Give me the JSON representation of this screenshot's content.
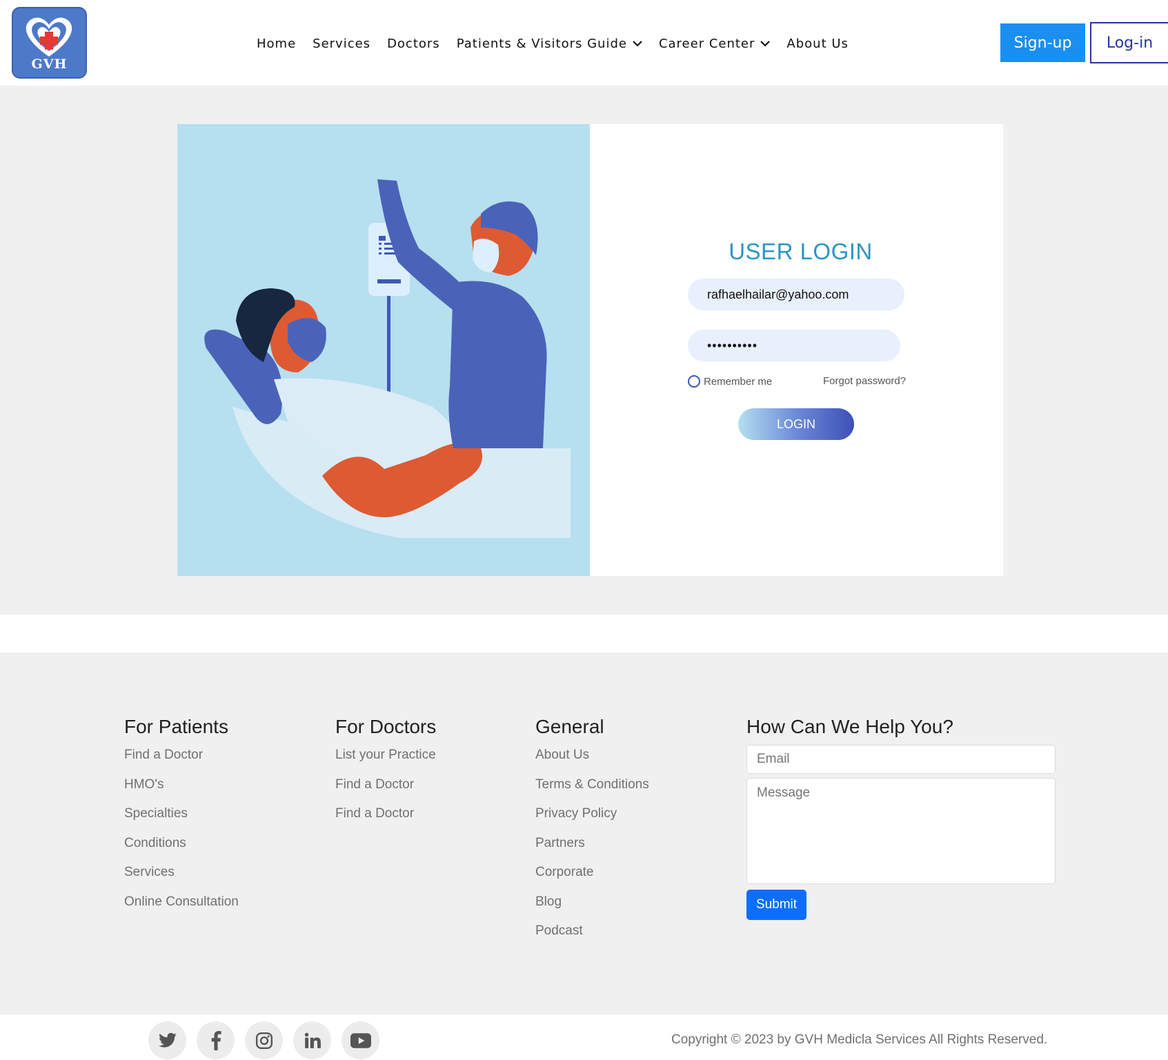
{
  "brand": {
    "logo_text": "GVH"
  },
  "nav": {
    "items": [
      {
        "label": "Home",
        "dropdown": false
      },
      {
        "label": "Services",
        "dropdown": false
      },
      {
        "label": "Doctors",
        "dropdown": false
      },
      {
        "label": "Patients & Visitors Guide",
        "dropdown": true
      },
      {
        "label": "Career Center",
        "dropdown": true
      },
      {
        "label": "About Us",
        "dropdown": false
      }
    ],
    "signup_label": "Sign-up",
    "login_label": "Log-in"
  },
  "login": {
    "title": "USER LOGIN",
    "email_value": "rafhaelhailar@yahoo.com",
    "password_value": "••••••••••",
    "remember_label": "Remember me",
    "forgot_label": "Forgot password?",
    "button_label": "LOGIN"
  },
  "footer": {
    "for_patients": {
      "title": "For Patients",
      "links": [
        "Find a Doctor",
        "HMO's",
        "Specialties",
        "Conditions",
        "Services",
        "Online Consultation"
      ]
    },
    "for_doctors": {
      "title": "For Doctors",
      "links": [
        "List your Practice",
        "Find a Doctor",
        "Find a Doctor"
      ]
    },
    "general": {
      "title": "General",
      "links": [
        "About Us",
        "Terms & Conditions",
        "Privacy Policy",
        "Partners",
        "Corporate",
        "Blog",
        "Podcast"
      ]
    },
    "help": {
      "title": "How Can We Help You?",
      "email_placeholder": "Email",
      "message_placeholder": "Message",
      "submit_label": "Submit"
    }
  },
  "social": [
    "twitter-icon",
    "facebook-icon",
    "instagram-icon",
    "linkedin-icon",
    "youtube-icon"
  ],
  "copyright": "Copyright © 2023 by GVH Medicla Services All Rights Reserved.",
  "colors": {
    "primary_blue": "#1a8ff0",
    "title_blue": "#2a95c4",
    "navy": "#2535a0",
    "submit_blue": "#0d6efd",
    "illustration_bg": "#b6dff0"
  }
}
